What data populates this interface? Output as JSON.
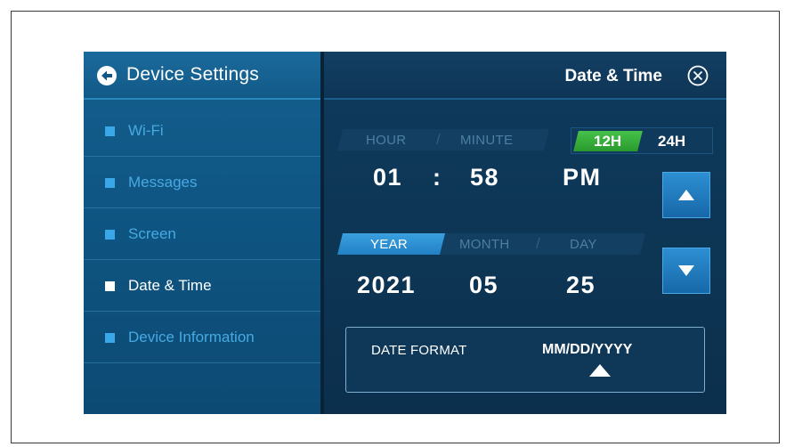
{
  "sidebar": {
    "title": "Device Settings",
    "items": [
      {
        "label": "Wi-Fi",
        "active": false
      },
      {
        "label": "Messages",
        "active": false
      },
      {
        "label": "Screen",
        "active": false
      },
      {
        "label": "Date & Time",
        "active": true
      },
      {
        "label": "Device Information",
        "active": false
      }
    ]
  },
  "header": {
    "title": "Date & Time"
  },
  "time": {
    "hour_label": "HOUR",
    "minute_label": "MINUTE",
    "hour": "01",
    "separator": ":",
    "minute": "58",
    "meridiem": "PM",
    "format_12h": "12H",
    "format_24h": "24H",
    "selected_format": "12H"
  },
  "date": {
    "year_label": "YEAR",
    "month_label": "MONTH",
    "day_label": "DAY",
    "year": "2021",
    "month": "05",
    "day": "25",
    "selected_field": "YEAR"
  },
  "date_format": {
    "label": "DATE FORMAT",
    "value": "MM/DD/YYYY"
  },
  "icons": {
    "back": "back-arrow-circle-icon",
    "close": "close-circle-icon",
    "up": "triangle-up-icon",
    "down": "triangle-down-icon"
  },
  "colors": {
    "accent_green": "#3bb53f",
    "accent_blue": "#2a8fd4",
    "sidebar_text": "#46a9e2"
  }
}
